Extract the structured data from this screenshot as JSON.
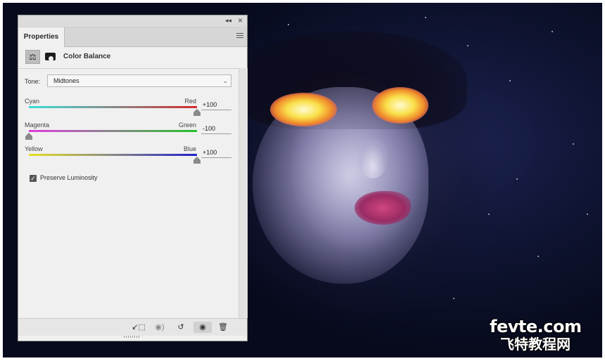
{
  "panel": {
    "tab_label": "Properties",
    "adjustment_title": "Color Balance",
    "icons": {
      "collapse": "double-chevron-right-icon",
      "close": "close-icon",
      "menu": "panel-menu-icon",
      "balance": "scales-icon",
      "mask": "layer-mask-icon"
    }
  },
  "tone": {
    "label": "Tone:",
    "selected": "Midtones"
  },
  "sliders": [
    {
      "left_label": "Cyan",
      "right_label": "Red",
      "value": "+100",
      "level": 100,
      "colors": [
        "#37e0d8",
        "#d42a2a"
      ]
    },
    {
      "left_label": "Magenta",
      "right_label": "Green",
      "value": "-100",
      "level": -100,
      "colors": [
        "#e03ce0",
        "#22c22a"
      ]
    },
    {
      "left_label": "Yellow",
      "right_label": "Blue",
      "value": "+100",
      "level": 100,
      "colors": [
        "#e6e020",
        "#2020c8"
      ]
    }
  ],
  "preserve_luminosity": {
    "label": "Preserve Luminosity",
    "checked": true
  },
  "bottom_toolbar": [
    {
      "name": "clip-to-layer-icon",
      "glyph": "⬚"
    },
    {
      "name": "view-previous-state-icon",
      "glyph": "◉"
    },
    {
      "name": "reset-icon",
      "glyph": "↺"
    },
    {
      "name": "visibility-eye-icon",
      "glyph": "👁"
    },
    {
      "name": "trash-icon",
      "glyph": "🗑"
    }
  ],
  "watermark": {
    "line1": "fevte.com",
    "line2": "飞特教程网"
  }
}
